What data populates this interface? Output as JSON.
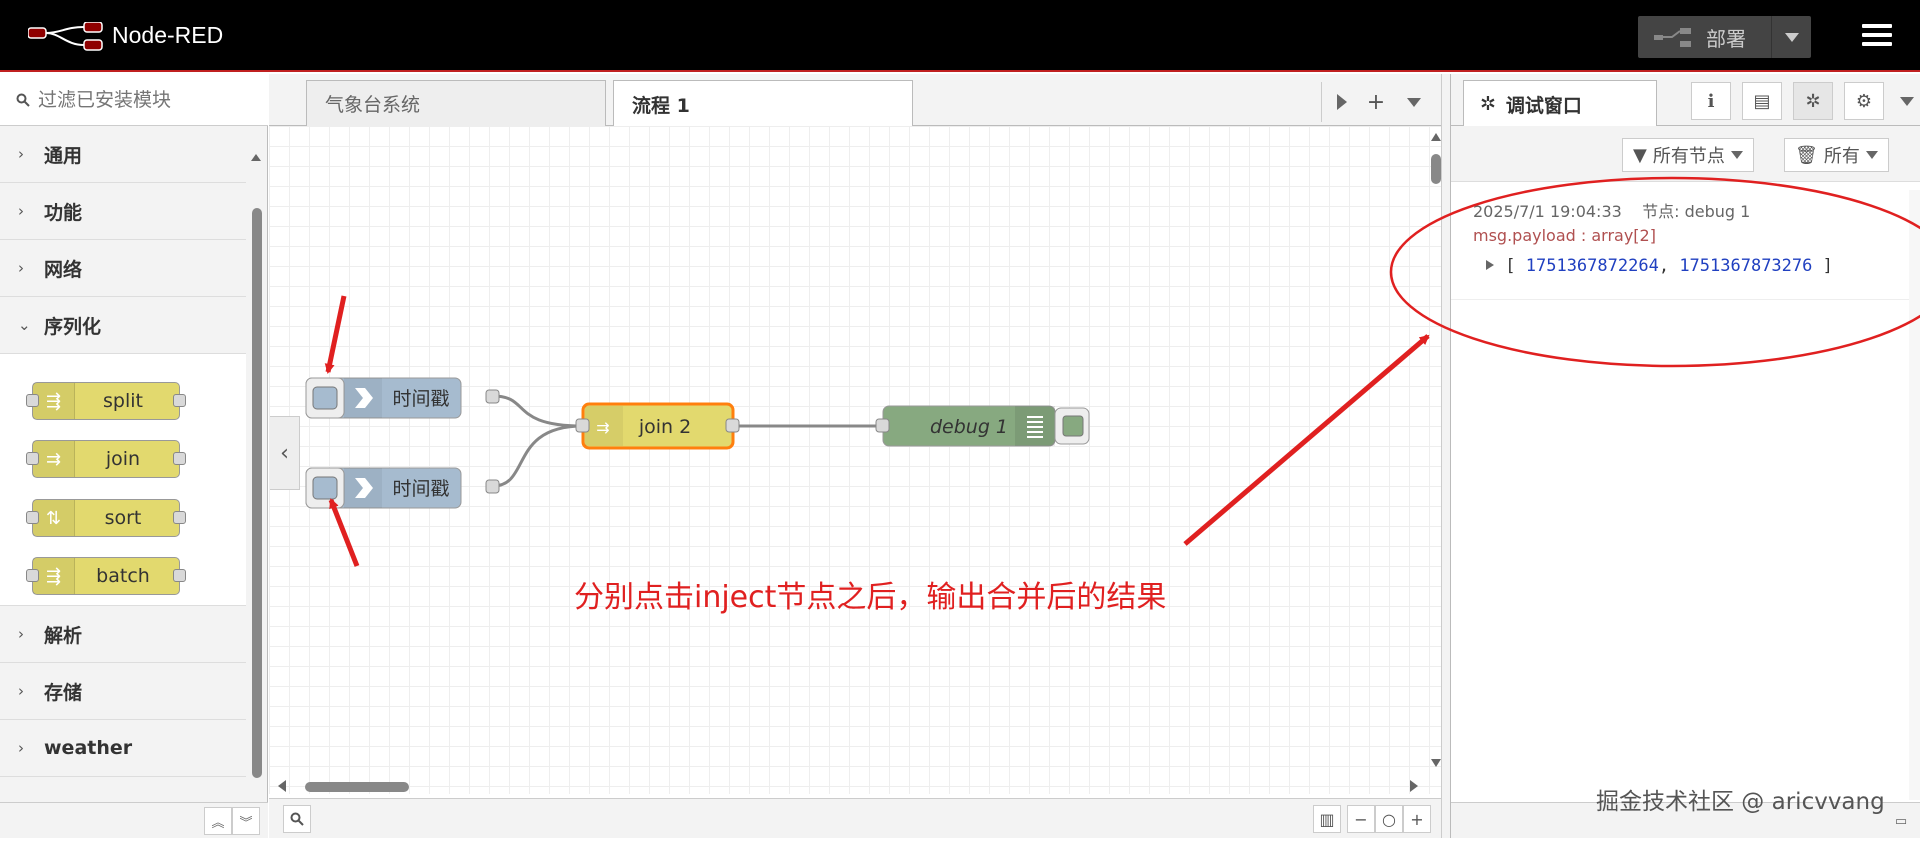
{
  "header": {
    "app_title": "Node-RED",
    "deploy_label": "部署"
  },
  "palette": {
    "search_placeholder": "过滤已安装模块",
    "categories_top": [
      {
        "label": "通用",
        "expanded": false
      },
      {
        "label": "功能",
        "expanded": false
      },
      {
        "label": "网络",
        "expanded": false
      },
      {
        "label": "序列化",
        "expanded": true
      }
    ],
    "nodes": [
      {
        "label": "split",
        "icon": "split-icon"
      },
      {
        "label": "join",
        "icon": "join-icon"
      },
      {
        "label": "sort",
        "icon": "sort-icon"
      },
      {
        "label": "batch",
        "icon": "batch-icon"
      }
    ],
    "categories_bottom": [
      {
        "label": "解析",
        "expanded": false
      },
      {
        "label": "存储",
        "expanded": false
      },
      {
        "label": "weather",
        "expanded": false
      }
    ]
  },
  "workspace": {
    "tabs": [
      {
        "label": "气象台系统",
        "active": false
      },
      {
        "label": "流程 1",
        "active": true
      }
    ],
    "flow_nodes": {
      "inject1": "时间戳",
      "inject2": "时间戳",
      "join": "join 2",
      "debug": "debug 1"
    },
    "annotation": "分别点击inject节点之后，输出合并后的结果"
  },
  "sidebar": {
    "active_tab": "调试窗口",
    "filter_nodes_label": "所有节点",
    "clear_label": "所有",
    "message": {
      "timestamp": "2025/7/1 19:04:33",
      "node_label": "节点: debug 1",
      "topic": "msg.payload : array[2]",
      "value_open": "[",
      "value_1": "1751367872264",
      "value_sep": ",",
      "value_2": "1751367873276",
      "value_close": "]"
    }
  },
  "watermark": "掘金技术社区 @ aricvvang",
  "colors": {
    "header_bg": "#000000",
    "inject_node": "#a6bbcf",
    "join_node": "#e2d96e",
    "debug_node": "#87a980",
    "selected_outline": "#ff7f0e",
    "annotation": "#e02020"
  }
}
